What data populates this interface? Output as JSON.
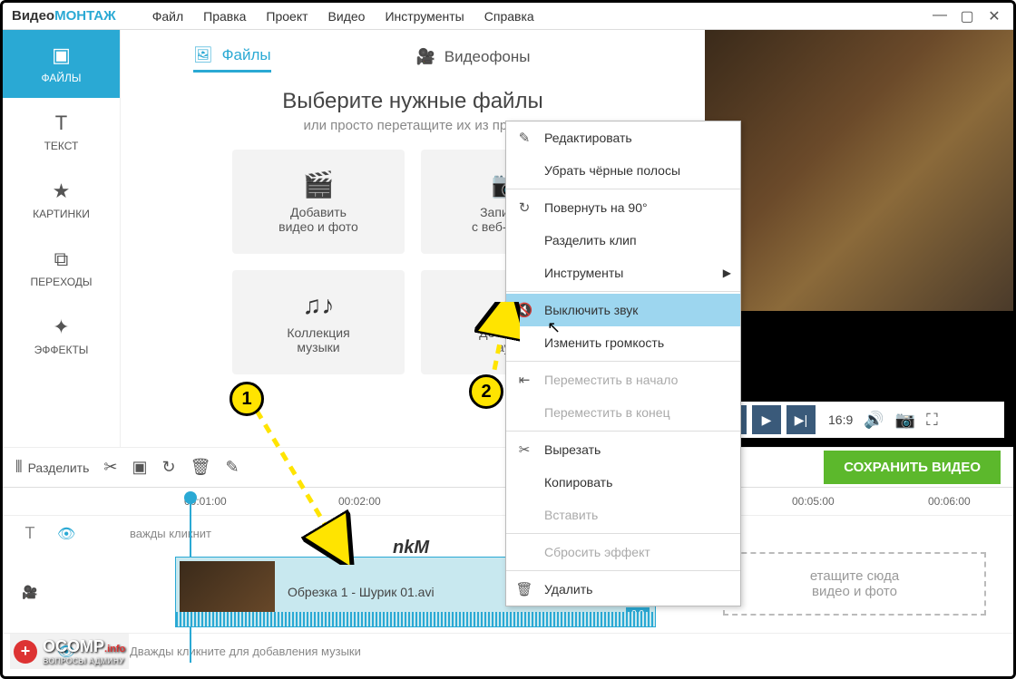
{
  "logo": {
    "part1": "Видео",
    "part2": "МОНТАЖ"
  },
  "menu": [
    "Файл",
    "Правка",
    "Проект",
    "Видео",
    "Инструменты",
    "Справка"
  ],
  "sidebar": [
    {
      "icon": "▣",
      "label": "ФАЙЛЫ"
    },
    {
      "icon": "T",
      "label": "ТЕКСТ"
    },
    {
      "icon": "★",
      "label": "КАРТИНКИ"
    },
    {
      "icon": "⧉",
      "label": "ПЕРЕХОДЫ"
    },
    {
      "icon": "✦",
      "label": "ЭФФЕКТЫ"
    }
  ],
  "tabs": {
    "files": "Файлы",
    "backgrounds": "Видеофоны"
  },
  "prompt": {
    "title": "Выберите нужные файлы",
    "sub": "или просто перетащите их из пров"
  },
  "cards": [
    {
      "line1": "Добавить",
      "line2": "видео и фото"
    },
    {
      "line1": "Записать",
      "line2": "с веб-камер"
    },
    {
      "line1": "Коллекция",
      "line2": "музыки"
    },
    {
      "line1": "Добавить",
      "line2": "ауд"
    }
  ],
  "context": [
    {
      "icon": "✎",
      "label": "Редактировать"
    },
    {
      "icon": "",
      "label": "Убрать чёрные полосы"
    },
    {
      "icon": "↻",
      "label": "Повернуть на 90°"
    },
    {
      "icon": "",
      "label": "Разделить клип"
    },
    {
      "icon": "",
      "label": "Инструменты",
      "sub": "▶"
    },
    {
      "icon": "🔇",
      "label": "Выключить звук",
      "hl": true
    },
    {
      "icon": "",
      "label": "Изменить громкость"
    },
    {
      "icon": "⇤",
      "label": "Переместить в начало",
      "dis": true
    },
    {
      "icon": "",
      "label": "Переместить в конец",
      "dis": true
    },
    {
      "icon": "✂",
      "label": "Вырезать"
    },
    {
      "icon": "",
      "label": "Копировать"
    },
    {
      "icon": "",
      "label": "Вставить",
      "dis": true
    },
    {
      "icon": "",
      "label": "Сбросить эффект",
      "dis": true
    },
    {
      "icon": "🗑",
      "label": "Удалить"
    }
  ],
  "toolbar": {
    "split": "Разделить",
    "save": "СОХРАНИТЬ ВИДЕО"
  },
  "ruler": [
    "00:01:00",
    "00:02:00",
    "00:05:00",
    "00:06:00"
  ],
  "track": {
    "textHint": "важды кликнит",
    "musicHint": "Дважды кликните для добавления музыки"
  },
  "clip": {
    "name": "Обрезка 1 - Шурик 01.avi",
    "speed": "2.0"
  },
  "dropzone": {
    "l1": "етащите сюда",
    "l2": "видео и фото"
  },
  "aspect": "16:9",
  "badges": {
    "b1": "1",
    "b2": "2"
  },
  "nkm": "nkM",
  "watermark": {
    "brand": "OCOMP",
    "domain": ".info",
    "tag": "ВОПРОСЫ АДМИНУ"
  }
}
